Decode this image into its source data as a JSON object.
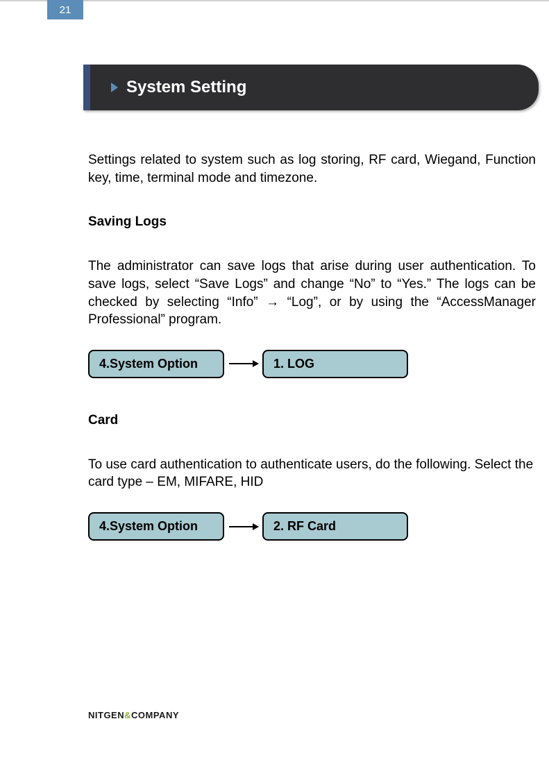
{
  "page_number": "21",
  "header": {
    "title": "System Setting"
  },
  "intro": "Settings related to system such as log storing, RF card, Wiegand, Function key, time, terminal mode and timezone.",
  "sections": [
    {
      "heading": "Saving Logs",
      "body": "The administrator can save logs that arise during user authentication. To save logs, select “Save Logs” and change “No” to “Yes.” The logs can be checked by selecting “Info” → “Log”, or by using the “AccessManager Professional” program.",
      "flow": {
        "from": "4.System Option",
        "to": "1. LOG"
      }
    },
    {
      "heading": "Card",
      "body": "To use card authentication to authenticate users, do the following. Select the card type – EM, MIFARE, HID",
      "flow": {
        "from": "4.System Option",
        "to": "2. RF Card"
      }
    }
  ],
  "footer": {
    "brand_part1": "NITGEN",
    "brand_amp": "&",
    "brand_part2": "COMPANY"
  }
}
